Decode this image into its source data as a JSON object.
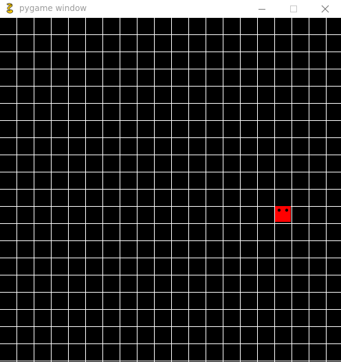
{
  "window": {
    "title": "pygame window",
    "app_icon": "pygame-snake-icon",
    "controls": {
      "minimize_icon": "minimize-icon",
      "maximize_icon": "maximize-icon",
      "close_icon": "close-icon"
    }
  },
  "game": {
    "background_color": "#000000",
    "grid_line_color": "#ffffff",
    "grid_columns": 20,
    "grid_rows": 20,
    "player": {
      "column": 16,
      "row": 11,
      "color": "#ff0000",
      "eye_color": "#000000",
      "eyes_icon": "two-eyes-icon"
    }
  }
}
